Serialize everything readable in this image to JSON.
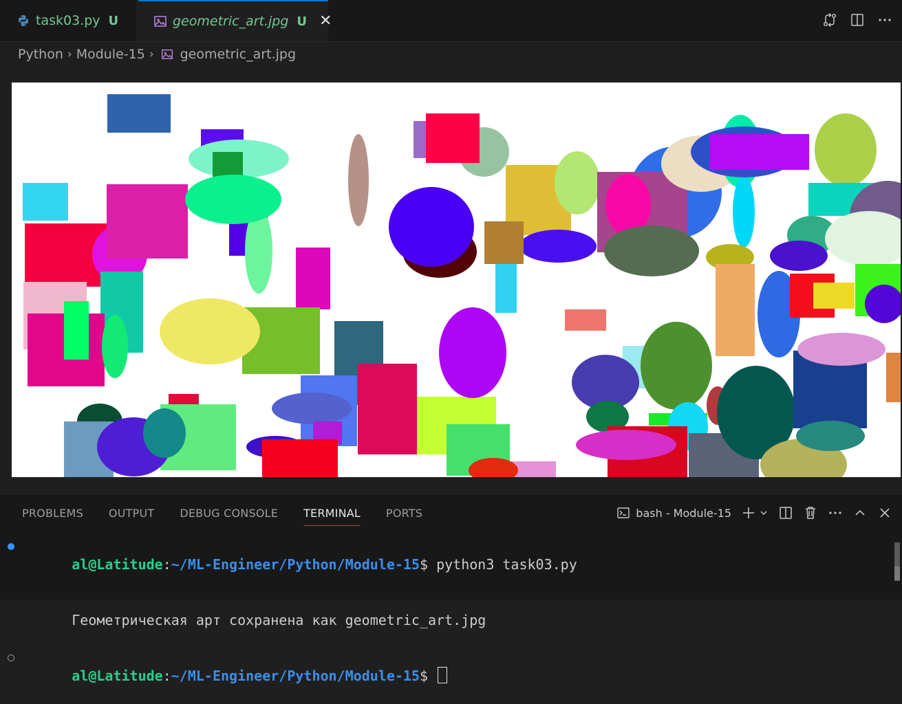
{
  "tabs": [
    {
      "name": "task03.py",
      "badge": "U",
      "icon": "python-icon"
    },
    {
      "name": "geometric_art.jpg",
      "badge": "U",
      "icon": "image-icon",
      "close": "✕"
    }
  ],
  "breadcrumb": {
    "items": [
      "Python",
      "Module-15",
      "geometric_art.jpg"
    ]
  },
  "panel": {
    "tabs": [
      "PROBLEMS",
      "OUTPUT",
      "DEBUG CONSOLE",
      "TERMINAL",
      "PORTS"
    ],
    "active_tab": "TERMINAL",
    "terminal_name": "bash - Module-15"
  },
  "terminal": {
    "line1_user": "al@Latitude",
    "line1_colon": ":",
    "line1_path": "~/ML-Engineer/Python/Module-15",
    "line1_cmd": "$ python3 task03.py",
    "line2": "Геометрическая арт сохранена как geometric_art.jpg",
    "line3_user": "al@Latitude",
    "line3_colon": ":",
    "line3_path": "~/ML-Engineer/Python/Module-15",
    "line3_prompt": "$ "
  },
  "colors": {
    "accent": "#0078d4",
    "untracked": "#73c991",
    "prompt_user": "#23d18b",
    "prompt_path": "#3b8eea"
  }
}
